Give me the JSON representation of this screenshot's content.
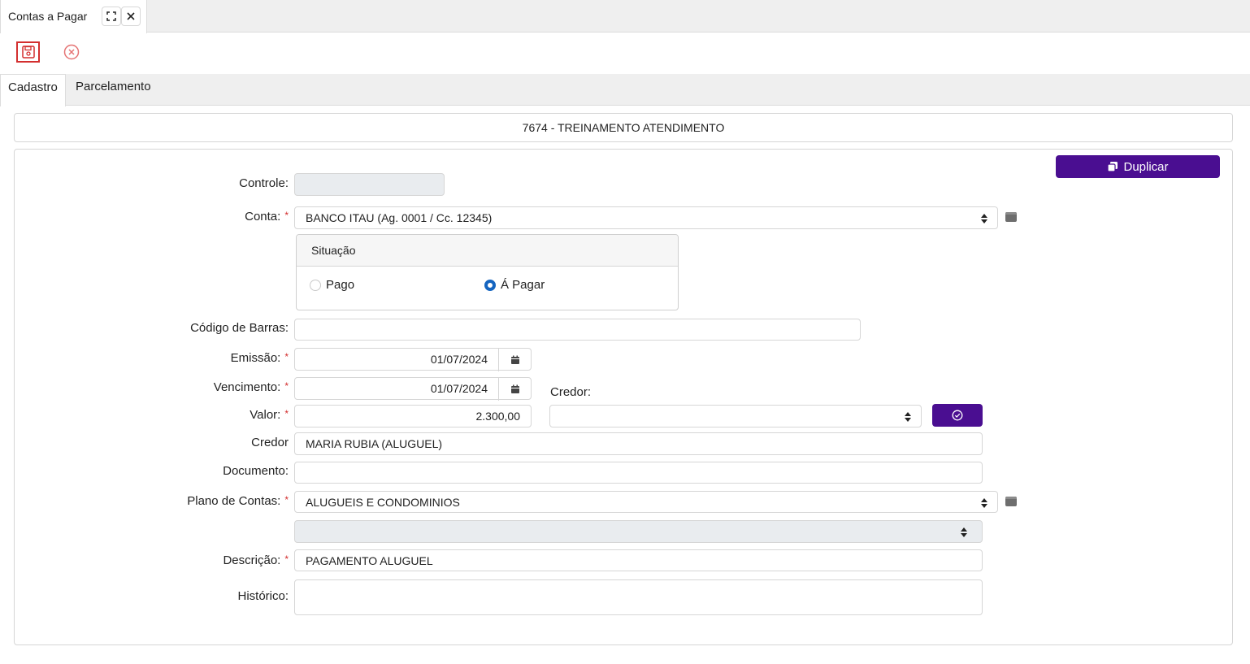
{
  "window": {
    "tab_title": "Contas a Pagar"
  },
  "tabs": [
    {
      "label": "Cadastro",
      "active": true
    },
    {
      "label": "Parcelamento",
      "active": false
    }
  ],
  "record_title": "7674 - TREINAMENTO ATENDIMENTO",
  "buttons": {
    "duplicate": "Duplicar"
  },
  "form": {
    "controle": {
      "label": "Controle:",
      "value": ""
    },
    "conta": {
      "label": "Conta:",
      "required_mark": "*",
      "value": "BANCO ITAU (Ag. 0001  / Cc. 12345)"
    },
    "situacao": {
      "title": "Situação",
      "options": [
        {
          "label": "Pago",
          "checked": false
        },
        {
          "label": "Á Pagar",
          "checked": true
        }
      ]
    },
    "codigo_barras": {
      "label": "Código de Barras:",
      "value": ""
    },
    "emissao": {
      "label": "Emissão:",
      "required_mark": "*",
      "value": "01/07/2024"
    },
    "vencimento": {
      "label": "Vencimento:",
      "required_mark": "*",
      "value": "01/07/2024"
    },
    "credor_select": {
      "label": "Credor:",
      "value": ""
    },
    "valor": {
      "label": "Valor:",
      "required_mark": "*",
      "value": "2.300,00"
    },
    "credor": {
      "label": "Credor",
      "value": "MARIA RUBIA (ALUGUEL)"
    },
    "documento": {
      "label": "Documento:",
      "value": ""
    },
    "plano_contas": {
      "label": "Plano de Contas:",
      "required_mark": "*",
      "value": "ALUGUEIS E CONDOMINIOS"
    },
    "sub_plano": {
      "value": ""
    },
    "descricao": {
      "label": "Descrição:",
      "required_mark": "*",
      "value": "PAGAMENTO ALUGUEL"
    },
    "historico": {
      "label": "Histórico:",
      "value": ""
    }
  },
  "icons": {
    "fullscreen": "expand-icon",
    "close": "close-icon",
    "save": "floppy-disk-icon",
    "cancel": "circle-x-icon",
    "calendar": "calendar-icon",
    "duplicate": "copy-icon",
    "confirm": "check-circle-icon",
    "list": "list-icon"
  },
  "colors": {
    "primary": "#4a0e91",
    "danger": "#d32f2f",
    "radio_checked": "#1565c0"
  }
}
